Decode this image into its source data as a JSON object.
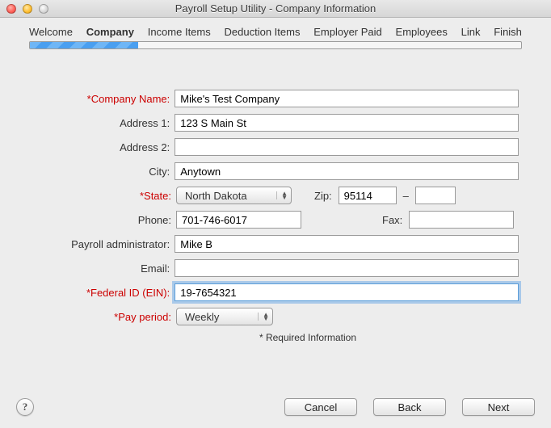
{
  "window": {
    "title": "Payroll Setup Utility - Company Information"
  },
  "steps": {
    "welcome": "Welcome",
    "company": "Company",
    "income": "Income Items",
    "deduction": "Deduction Items",
    "employer": "Employer Paid",
    "employees": "Employees",
    "link": "Link",
    "finish": "Finish"
  },
  "labels": {
    "company_name": "*Company Name:",
    "address1": "Address 1:",
    "address2": "Address 2:",
    "city": "City:",
    "state": "*State:",
    "zip": "Zip:",
    "phone": "Phone:",
    "fax": "Fax:",
    "payroll_admin": "Payroll administrator:",
    "email": "Email:",
    "federal_id": "*Federal ID (EIN):",
    "pay_period": "*Pay period:",
    "required_note": "* Required Information"
  },
  "values": {
    "company_name": "Mike's Test Company",
    "address1": "123 S Main St",
    "address2": "",
    "city": "Anytown",
    "state": "North Dakota",
    "zip": "95114",
    "zip2": "",
    "phone": "701-746-6017",
    "fax": "",
    "payroll_admin": "Mike B",
    "email": "",
    "federal_id": "19-7654321",
    "pay_period": "Weekly"
  },
  "buttons": {
    "cancel": "Cancel",
    "back": "Back",
    "next": "Next"
  },
  "help": "?"
}
